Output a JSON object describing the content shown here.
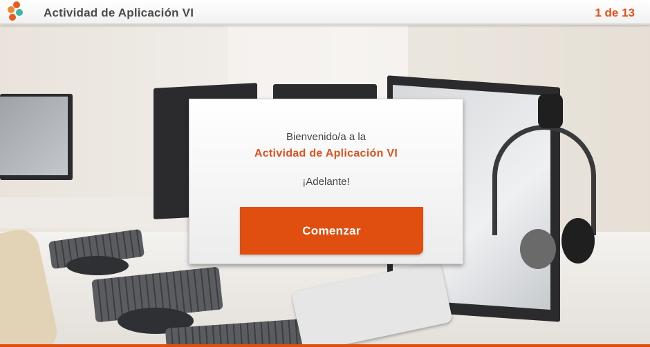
{
  "header": {
    "title": "Actividad de Aplicación VI",
    "page_counter": "1 de 13",
    "logo_icon": "four-dot-logo-icon"
  },
  "card": {
    "welcome_text": "Bienvenido/a a la",
    "activity_name": "Actividad de Aplicación VI",
    "encouragement": "¡Adelante!",
    "start_button_label": "Comenzar"
  },
  "colors": {
    "accent": "#e14f10",
    "title_gray": "#4a4a4a",
    "logo_teal": "#3db4a4"
  },
  "background": {
    "description_icon": "office-computers-headset-photo"
  }
}
